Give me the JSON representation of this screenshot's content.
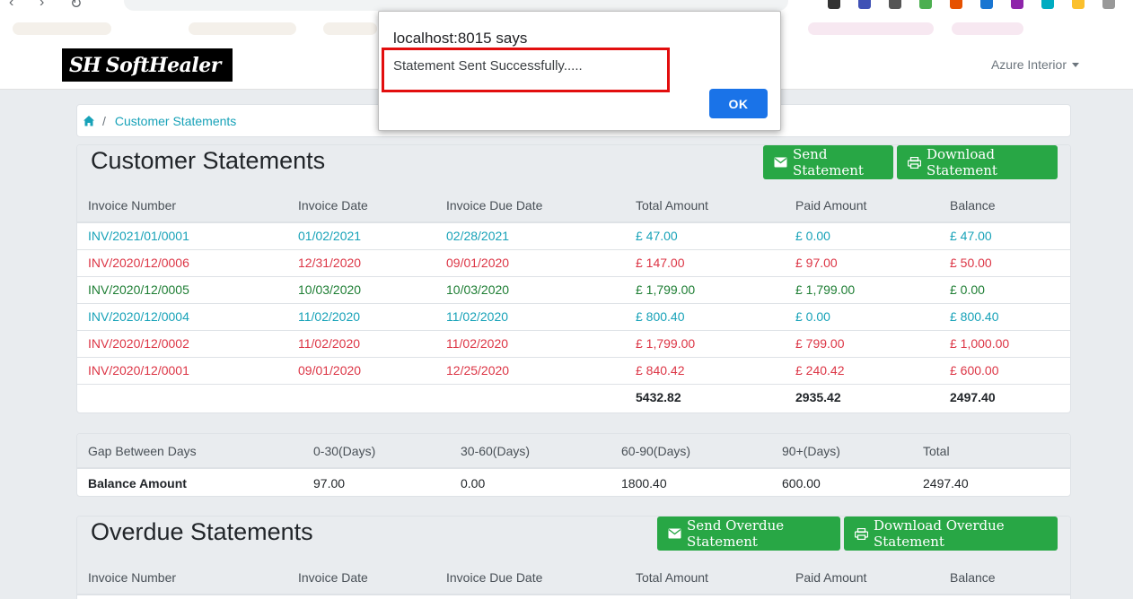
{
  "header": {
    "brand": "SoftHealer",
    "brand_mark": "SH",
    "user_menu": "Azure Interior"
  },
  "breadcrumb": {
    "current": "Customer Statements"
  },
  "statements": {
    "title": "Customer Statements",
    "send_label": "Send Statement",
    "download_label": "Download Statement",
    "columns": [
      "Invoice Number",
      "Invoice Date",
      "Invoice Due Date",
      "Total Amount",
      "Paid Amount",
      "Balance"
    ],
    "rows": [
      {
        "invoice": "INV/2021/01/0001",
        "date": "01/02/2021",
        "due": "02/28/2021",
        "total": "£ 47.00",
        "paid": "£ 0.00",
        "balance": "£ 47.00",
        "status": "blue"
      },
      {
        "invoice": "INV/2020/12/0006",
        "date": "12/31/2020",
        "due": "09/01/2020",
        "total": "£ 147.00",
        "paid": "£ 97.00",
        "balance": "£ 50.00",
        "status": "red"
      },
      {
        "invoice": "INV/2020/12/0005",
        "date": "10/03/2020",
        "due": "10/03/2020",
        "total": "£ 1,799.00",
        "paid": "£ 1,799.00",
        "balance": "£ 0.00",
        "status": "green"
      },
      {
        "invoice": "INV/2020/12/0004",
        "date": "11/02/2020",
        "due": "11/02/2020",
        "total": "£ 800.40",
        "paid": "£ 0.00",
        "balance": "£ 800.40",
        "status": "blue"
      },
      {
        "invoice": "INV/2020/12/0002",
        "date": "11/02/2020",
        "due": "11/02/2020",
        "total": "£ 1,799.00",
        "paid": "£ 799.00",
        "balance": "£ 1,000.00",
        "status": "red"
      },
      {
        "invoice": "INV/2020/12/0001",
        "date": "09/01/2020",
        "due": "12/25/2020",
        "total": "£ 840.42",
        "paid": "£ 240.42",
        "balance": "£ 600.00",
        "status": "red"
      }
    ],
    "totals": {
      "total": "5432.82",
      "paid": "2935.42",
      "balance": "2497.40"
    }
  },
  "aging": {
    "columns": [
      "Gap Between Days",
      "0-30(Days)",
      "30-60(Days)",
      "60-90(Days)",
      "90+(Days)",
      "Total"
    ],
    "row": [
      "Balance Amount",
      "97.00",
      "0.00",
      "1800.40",
      "600.00",
      "2497.40"
    ]
  },
  "overdue": {
    "title": "Overdue Statements",
    "send_label": "Send Overdue Statement",
    "download_label": "Download Overdue Statement",
    "columns": [
      "Invoice Number",
      "Invoice Date",
      "Invoice Due Date",
      "Total Amount",
      "Paid Amount",
      "Balance"
    ]
  },
  "dialog": {
    "title": "localhost:8015 says",
    "message": "Statement Sent Successfully.....",
    "ok_label": "OK"
  },
  "colors": {
    "paid_blue": "#17a2b8",
    "overdue_red": "#dc3545",
    "settled_green": "#1e7e34",
    "button_green": "#28a745",
    "dialog_ok": "#1a73e8",
    "highlight": "#e20e0e"
  }
}
